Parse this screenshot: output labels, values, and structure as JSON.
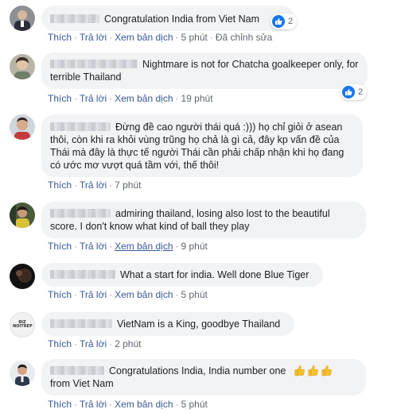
{
  "comments": [
    {
      "text": "Congratulation India from Viet Nam",
      "actions": {
        "like": "Thích",
        "reply": "Trả lời",
        "translate": "Xem bản dịch",
        "time": "5 phút",
        "edited": "Đã chỉnh sửa"
      },
      "reactions": "2"
    },
    {
      "text": "Nightmare is not for Chatcha goalkeeper only, for terrible Thailand",
      "actions": {
        "like": "Thích",
        "reply": "Trả lời",
        "translate": "Xem bản dịch",
        "time": "19 phút"
      },
      "reactions": "2"
    },
    {
      "text": "Đừng đề cao người thái quá :))) họ chỉ giỏi ở asean thôi, còn khi ra khỏi vùng trũng họ chả là gì cả, đây kp vấn đề của Thái mà đây là thực tế người Thái cần phải chấp nhận khi họ đang có ước mơ vượt quá tầm với, thế thôi!",
      "actions": {
        "like": "Thích",
        "reply": "Trả lời",
        "time": "7 phút"
      }
    },
    {
      "text": "admiring thailand, losing also lost to the beautiful score. I don't know what kind of ball they play",
      "actions": {
        "like": "Thích",
        "reply": "Trả lời",
        "translate": "Xem bản dịch",
        "time": "9 phút"
      }
    },
    {
      "text": "What a start for india. Well done Blue Tiger",
      "actions": {
        "like": "Thích",
        "reply": "Trả lời",
        "translate": "Xem bản dịch",
        "time": "5 phút"
      }
    },
    {
      "text": "VietNam is a King, goodbye Thailand",
      "actions": {
        "like": "Thích",
        "reply": "Trả lời",
        "time": "2 phút"
      },
      "avatar_text": "BIZ NOITREP"
    },
    {
      "text": "Congratulations India, India number one",
      "text2": "from Viet Nam",
      "actions": {
        "like": "Thích",
        "reply": "Trả lời",
        "translate": "Xem bản dịch",
        "time": "5 phút"
      }
    }
  ],
  "colors": {
    "bubble": "#f2f3f5",
    "link": "#385898",
    "meta": "#606770",
    "like_blue": "#1877f2"
  }
}
